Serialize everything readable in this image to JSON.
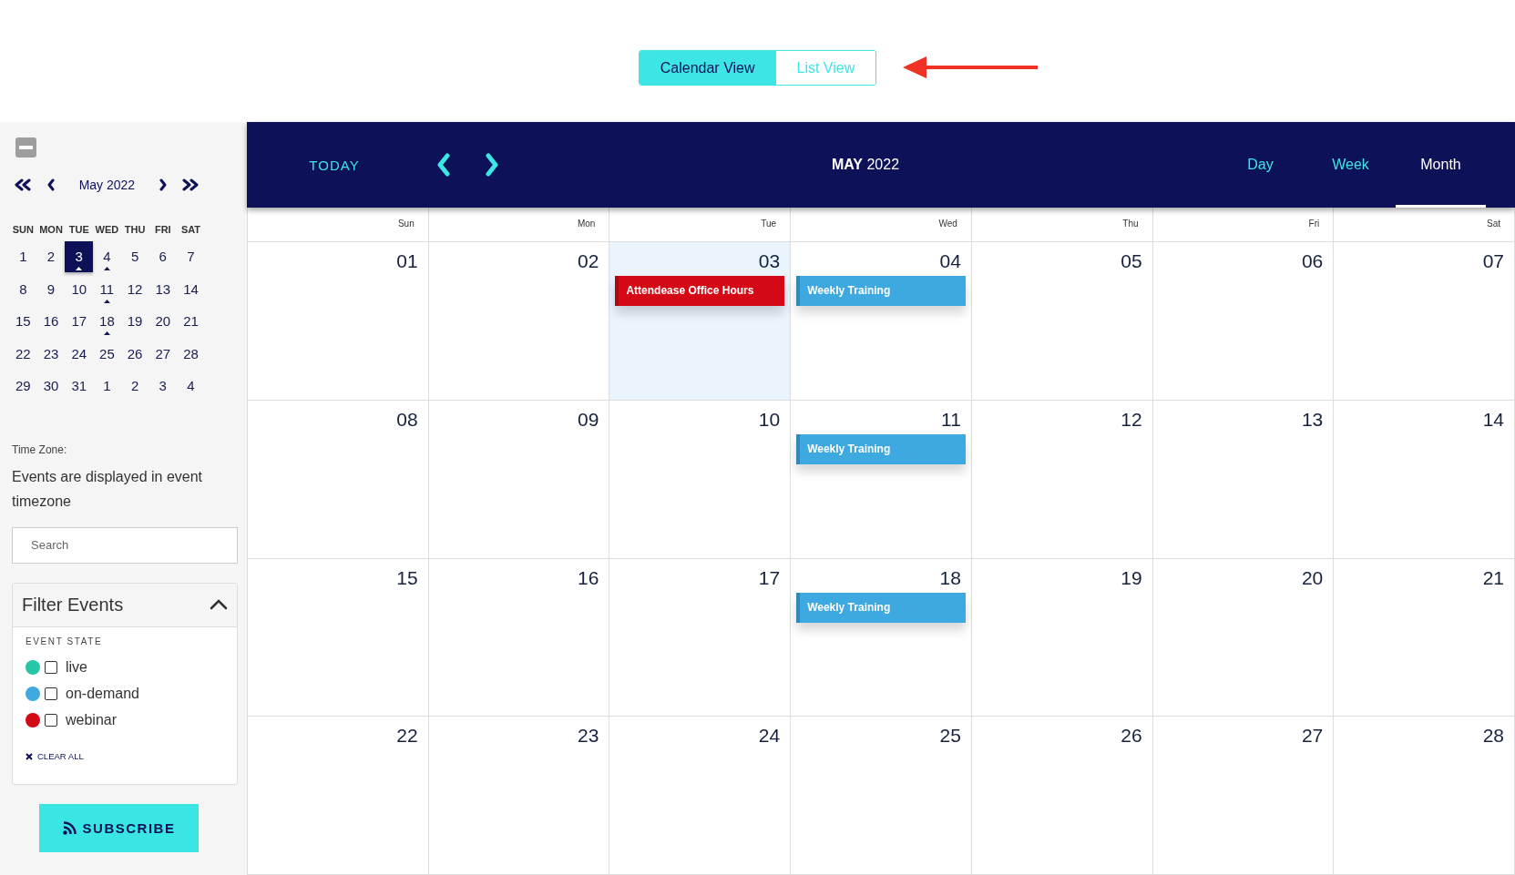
{
  "view_toggle": [
    {
      "label": "Calendar View",
      "selected": true
    },
    {
      "label": "List View",
      "selected": false
    }
  ],
  "sidebar": {
    "mini_calendar": {
      "month_label": "May 2022",
      "weekdays": [
        "SUN",
        "MON",
        "TUE",
        "WED",
        "THU",
        "FRI",
        "SAT"
      ],
      "weeks": [
        [
          {
            "day": "1",
            "selected": false,
            "has_events": false
          },
          {
            "day": "2",
            "selected": false,
            "has_events": false
          },
          {
            "day": "3",
            "selected": true,
            "has_events": true
          },
          {
            "day": "4",
            "selected": false,
            "has_events": true
          },
          {
            "day": "5",
            "selected": false,
            "has_events": false
          },
          {
            "day": "6",
            "selected": false,
            "has_events": false
          },
          {
            "day": "7",
            "selected": false,
            "has_events": false
          }
        ],
        [
          {
            "day": "8",
            "selected": false,
            "has_events": false
          },
          {
            "day": "9",
            "selected": false,
            "has_events": false
          },
          {
            "day": "10",
            "selected": false,
            "has_events": false
          },
          {
            "day": "11",
            "selected": false,
            "has_events": true
          },
          {
            "day": "12",
            "selected": false,
            "has_events": false
          },
          {
            "day": "13",
            "selected": false,
            "has_events": false
          },
          {
            "day": "14",
            "selected": false,
            "has_events": false
          }
        ],
        [
          {
            "day": "15",
            "selected": false,
            "has_events": false
          },
          {
            "day": "16",
            "selected": false,
            "has_events": false
          },
          {
            "day": "17",
            "selected": false,
            "has_events": false
          },
          {
            "day": "18",
            "selected": false,
            "has_events": true
          },
          {
            "day": "19",
            "selected": false,
            "has_events": false
          },
          {
            "day": "20",
            "selected": false,
            "has_events": false
          },
          {
            "day": "21",
            "selected": false,
            "has_events": false
          }
        ],
        [
          {
            "day": "22",
            "selected": false,
            "has_events": false
          },
          {
            "day": "23",
            "selected": false,
            "has_events": false
          },
          {
            "day": "24",
            "selected": false,
            "has_events": false
          },
          {
            "day": "25",
            "selected": false,
            "has_events": false
          },
          {
            "day": "26",
            "selected": false,
            "has_events": false
          },
          {
            "day": "27",
            "selected": false,
            "has_events": false
          },
          {
            "day": "28",
            "selected": false,
            "has_events": false
          }
        ],
        [
          {
            "day": "29",
            "selected": false,
            "has_events": false
          },
          {
            "day": "30",
            "selected": false,
            "has_events": false
          },
          {
            "day": "31",
            "selected": false,
            "has_events": false
          },
          {
            "day": "1",
            "selected": false,
            "has_events": false
          },
          {
            "day": "2",
            "selected": false,
            "has_events": false
          },
          {
            "day": "3",
            "selected": false,
            "has_events": false
          },
          {
            "day": "4",
            "selected": false,
            "has_events": false
          }
        ]
      ]
    },
    "time_zone": {
      "label": "Time Zone:",
      "text": "Events are displayed in event timezone"
    },
    "search": {
      "placeholder": "Search"
    },
    "filter": {
      "title": "Filter Events",
      "expanded": true,
      "section_label": "EVENT STATE",
      "options": [
        {
          "label": "live",
          "color": "#26c6a6",
          "checked": false
        },
        {
          "label": "on-demand",
          "color": "#3fa9e0",
          "checked": false
        },
        {
          "label": "webinar",
          "color": "#d40916",
          "checked": false
        }
      ],
      "clear_label": "CLEAR ALL"
    },
    "subscribe": {
      "label": "SUBSCRIBE"
    }
  },
  "toolbar": {
    "today_label": "TODAY",
    "title": "**MAY** 2022",
    "views": [
      {
        "label": "Day",
        "selected": false
      },
      {
        "label": "Week",
        "selected": false
      },
      {
        "label": "Month",
        "selected": true
      }
    ]
  },
  "month_grid": {
    "weekdays": [
      "Sun",
      "Mon",
      "Tue",
      "Wed",
      "Thu",
      "Fri",
      "Sat"
    ],
    "weeks": [
      [
        {
          "day": "01",
          "today": false
        },
        {
          "day": "02",
          "today": false
        },
        {
          "day": "03",
          "today": true,
          "events": [
            {
              "title": "Attendease Office Hours",
              "color": "#d50916"
            }
          ]
        },
        {
          "day": "04",
          "today": false,
          "events": [
            {
              "title": "Weekly Training",
              "color": "#3ea8e0"
            }
          ]
        },
        {
          "day": "05",
          "today": false
        },
        {
          "day": "06",
          "today": false
        },
        {
          "day": "07",
          "today": false
        }
      ],
      [
        {
          "day": "08",
          "today": false
        },
        {
          "day": "09",
          "today": false
        },
        {
          "day": "10",
          "today": false
        },
        {
          "day": "11",
          "today": false,
          "events": [
            {
              "title": "Weekly Training",
              "color": "#3ea8e0"
            }
          ]
        },
        {
          "day": "12",
          "today": false
        },
        {
          "day": "13",
          "today": false
        },
        {
          "day": "14",
          "today": false
        }
      ],
      [
        {
          "day": "15",
          "today": false
        },
        {
          "day": "16",
          "today": false
        },
        {
          "day": "17",
          "today": false
        },
        {
          "day": "18",
          "today": false,
          "events": [
            {
              "title": "Weekly Training",
              "color": "#3ea8e0"
            }
          ]
        },
        {
          "day": "19",
          "today": false
        },
        {
          "day": "20",
          "today": false
        },
        {
          "day": "21",
          "today": false
        }
      ],
      [
        {
          "day": "22",
          "today": false
        },
        {
          "day": "23",
          "today": false
        },
        {
          "day": "24",
          "today": false
        },
        {
          "day": "25",
          "today": false
        },
        {
          "day": "26",
          "today": false
        },
        {
          "day": "27",
          "today": false
        },
        {
          "day": "28",
          "today": false
        }
      ]
    ]
  }
}
